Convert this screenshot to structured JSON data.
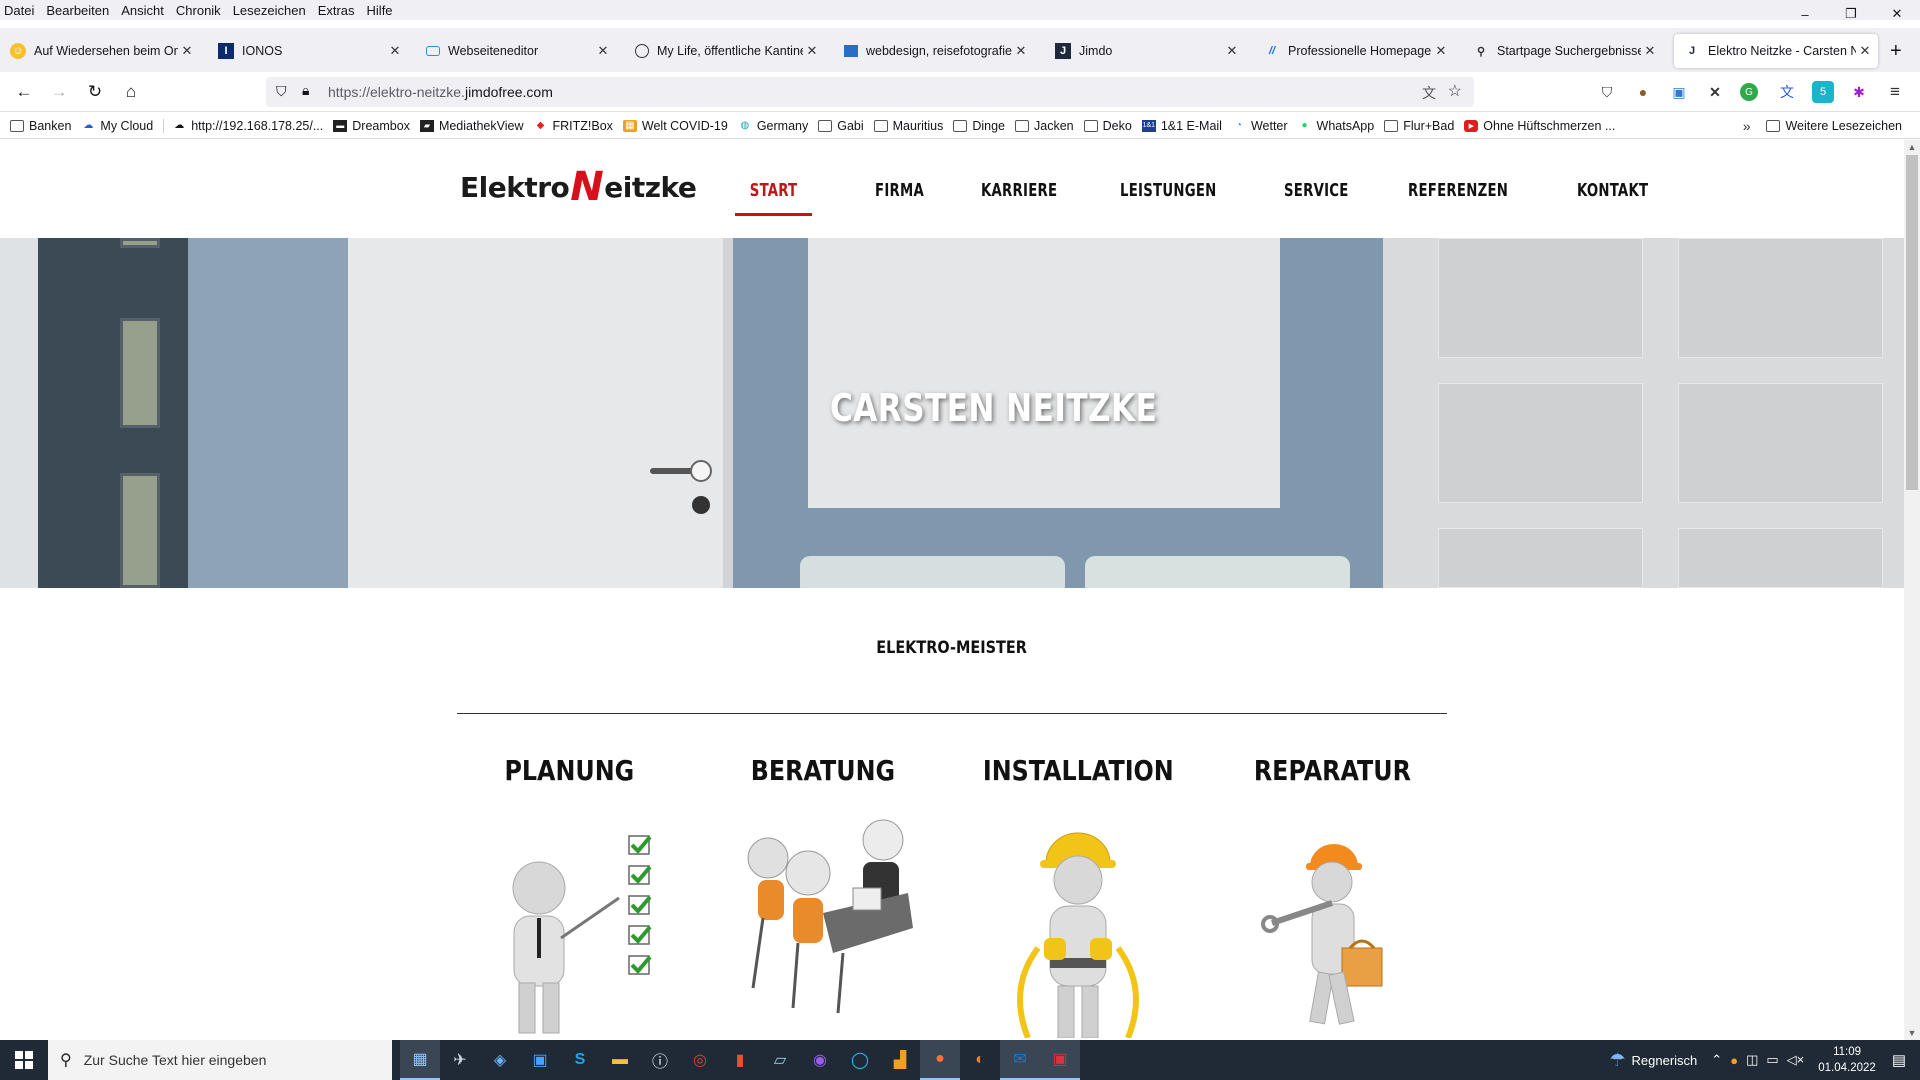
{
  "menubar": {
    "items": [
      "Datei",
      "Bearbeiten",
      "Ansicht",
      "Chronik",
      "Lesezeichen",
      "Extras",
      "Hilfe"
    ]
  },
  "window_controls": {
    "minimize": "–",
    "restore": "❐",
    "close": "✕"
  },
  "tabs": [
    {
      "title": "Auf Wiedersehen beim Onlin",
      "icon": "smiley-icon"
    },
    {
      "title": "IONOS",
      "icon": "ionos-icon"
    },
    {
      "title": "Webseiteneditor",
      "icon": "editor-icon"
    },
    {
      "title": "My Life, öffentliche Kantine",
      "icon": "globe-icon"
    },
    {
      "title": "webdesign, reisefotografie, e",
      "icon": "window-icon"
    },
    {
      "title": "Jimdo",
      "icon": "jimdo-icon"
    },
    {
      "title": "Professionelle Homepage Le",
      "icon": "wix-icon"
    },
    {
      "title": "Startpage Suchergebnisse",
      "icon": "search-icon"
    },
    {
      "title": "Elektro Neitzke - Carsten Nei",
      "icon": "jimdo-icon",
      "active": true
    }
  ],
  "newtab": "+",
  "url": {
    "prefix": "https://elektro-neitzke.",
    "domain": "jimdofree.com"
  },
  "bookmarks": [
    {
      "label": "Banken",
      "icon": "folder-icon"
    },
    {
      "label": "My Cloud",
      "icon": "cloud-icon"
    },
    {
      "label": "http://192.168.178.25/...",
      "icon": "cloud-icon"
    },
    {
      "label": "Dreambox",
      "icon": "dreambox-icon"
    },
    {
      "label": "MediathekView",
      "icon": "clapper-icon"
    },
    {
      "label": "FRITZ!Box",
      "icon": "fritz-icon"
    },
    {
      "label": "Welt COVID-19",
      "icon": "covid-icon"
    },
    {
      "label": "Germany",
      "icon": "germany-icon"
    },
    {
      "label": "Gabi",
      "icon": "folder-icon"
    },
    {
      "label": "Mauritius",
      "icon": "folder-icon"
    },
    {
      "label": "Dinge",
      "icon": "folder-icon"
    },
    {
      "label": "Jacken",
      "icon": "folder-icon"
    },
    {
      "label": "Deko",
      "icon": "folder-icon"
    },
    {
      "label": "1&1 E-Mail",
      "icon": "mail-icon"
    },
    {
      "label": "Wetter",
      "icon": "weather-icon"
    },
    {
      "label": "WhatsApp",
      "icon": "whatsapp-icon"
    },
    {
      "label": "Flur+Bad",
      "icon": "folder-icon"
    },
    {
      "label": "Ohne Hüftschmerzen ...",
      "icon": "youtube-icon"
    }
  ],
  "bookmarks_more": "Weitere Lesezeichen",
  "site": {
    "logo_left": "Elektro",
    "logo_n": "N",
    "logo_right": "eitzke",
    "nav": [
      "START",
      "FIRMA",
      "KARRIERE",
      "LEISTUNGEN",
      "SERVICE",
      "REFERENZEN",
      "KONTAKT"
    ],
    "hero_title": "CARSTEN NEITZKE",
    "subtitle": "ELEKTRO-MEISTER",
    "services": [
      "PLANUNG",
      "BERATUNG",
      "INSTALLATION",
      "REPARATUR"
    ]
  },
  "taskbar": {
    "search_placeholder": "Zur Suche Text hier eingeben",
    "weather": "Regnerisch",
    "time": "11:09",
    "date": "01.04.2022"
  },
  "colors": {
    "accent": "#c0151a",
    "taskbar": "#1f2a36"
  }
}
